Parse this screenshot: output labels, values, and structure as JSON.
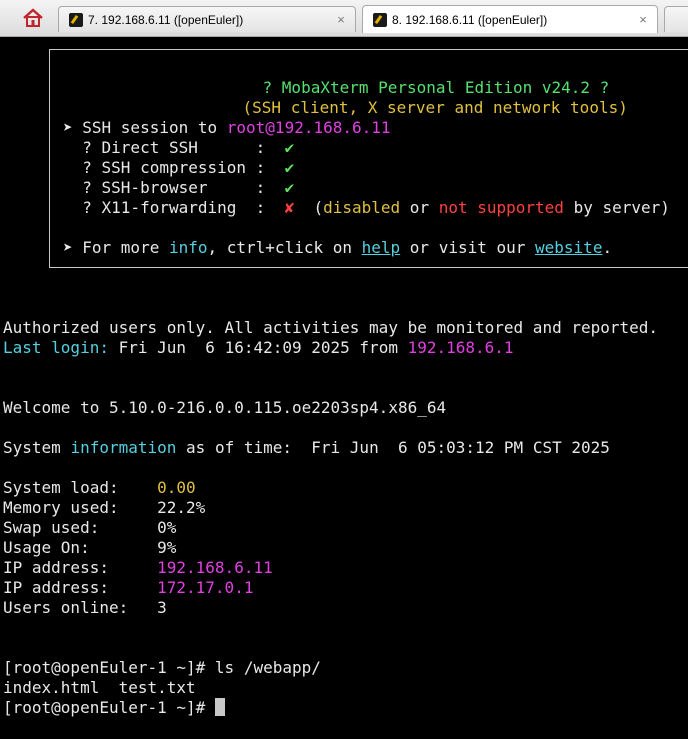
{
  "tabs": [
    {
      "label": "7. 192.168.6.11 ([openEuler])",
      "close": "×"
    },
    {
      "label": "8. 192.168.6.11 ([openEuler])",
      "close": "×"
    },
    {
      "label": ""
    }
  ],
  "banner": {
    "title": "? MobaXterm Personal Edition v24.2 ?",
    "subtitle": "(SSH client, X server and network tools)",
    "session_prefix": "➤ SSH session to ",
    "session_target": "root@192.168.6.11",
    "features": [
      {
        "label": "  ? Direct SSH      :  ",
        "mark": "✔"
      },
      {
        "label": "  ? SSH compression :  ",
        "mark": "✔"
      },
      {
        "label": "  ? SSH-browser     :  ",
        "mark": "✔"
      },
      {
        "label": "  ? X11-forwarding  :  ",
        "mark": "✘"
      }
    ],
    "x11_note": {
      "open": "(",
      "disabled": "disabled",
      "or": " or ",
      "not_supported": "not supported",
      "tail": " by server)"
    },
    "more_prefix": "➤ For more ",
    "more_info": "info",
    "more_mid": ", ctrl+click on ",
    "more_help": "help",
    "more_mid2": " or visit our ",
    "more_website": "website",
    "more_end": "."
  },
  "terminal": {
    "authorized": "Authorized users only. All activities may be monitored and reported.",
    "last_login_label": "Last login:",
    "last_login_time": " Fri Jun  6 16:42:09 2025 from ",
    "last_login_ip": "192.168.6.1",
    "welcome": "Welcome to 5.10.0-216.0.0.115.oe2203sp4.x86_64",
    "sysinfo_pre": "System ",
    "sysinfo_word": "information",
    "sysinfo_post": " as of time:  Fri Jun  6 05:03:12 PM CST 2025",
    "stats": [
      {
        "label": "System load:    ",
        "value": "0.00"
      },
      {
        "label": "Memory used:    ",
        "value": "22.2%"
      },
      {
        "label": "Swap used:      ",
        "value": "0%"
      },
      {
        "label": "Usage On:       ",
        "value": "9%"
      },
      {
        "label": "IP address:     ",
        "value": "192.168.6.11"
      },
      {
        "label": "IP address:     ",
        "value": "172.17.0.1"
      },
      {
        "label": "Users online:   ",
        "value": "3"
      }
    ],
    "cmd1": "[root@openEuler-1 ~]# ls /webapp/",
    "ls_output": "index.html  test.txt",
    "prompt": "[root@openEuler-1 ~]# "
  }
}
